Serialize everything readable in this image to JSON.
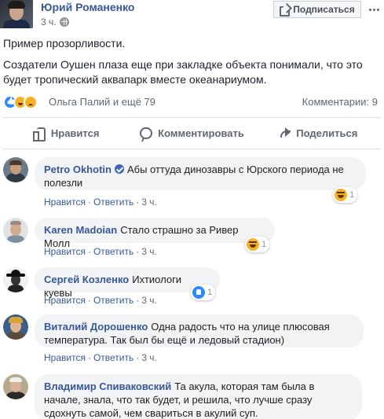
{
  "post": {
    "author": "Юрий Романенко",
    "time": "3 ч.",
    "subscribe_label": "Подписаться",
    "text_1": "Пример прозорливости.",
    "text_2": "Создатели Оушен плаза еще при закладке объекта понимали, что это будет тропический аквапарк вместе океанариумом.",
    "reaction_names": "Ольга Палий и ещё 79",
    "comment_count": "Комментарии: 9"
  },
  "actions": {
    "like": "Нравится",
    "comment": "Комментировать",
    "share": "Поделиться"
  },
  "comment_actions": {
    "like": "Нравится",
    "reply": "Ответить",
    "separator": "·"
  },
  "comments": [
    {
      "author": "Petro Okhotin",
      "verified": true,
      "text": "Абы оттуда динозавры с Юрского периода не полезли",
      "time": "3 ч.",
      "reaction": "haha",
      "reaction_count": "1"
    },
    {
      "author": "Karen Madoian",
      "text": "Стало страшно за Ривер Молл",
      "time": "3 ч.",
      "reaction": "haha",
      "reaction_count": "1"
    },
    {
      "author": "Сергей Козленко",
      "text": "Ихтиологи куевы",
      "time": "3 ч.",
      "reaction": "like",
      "reaction_count": "1"
    },
    {
      "author": "Виталий Дорошенко",
      "text": "Одна радость что на улице плюсовая температура. Так был бы ещё и ледовый стадион)",
      "time": "3 ч."
    },
    {
      "author": "Владимир Спиваковский",
      "text": "Та акула, которая там была в начале, знала, что так будет, и решила, что лучше сразу сдохнуть самой, чем свариться в акулий суп."
    }
  ],
  "colors": {
    "link_blue": "#385898",
    "meta_gray": "#606770",
    "bubble_gray": "#f2f3f5",
    "like_blue": "#2d88ff",
    "emoji_yellow": "#f7b125"
  }
}
